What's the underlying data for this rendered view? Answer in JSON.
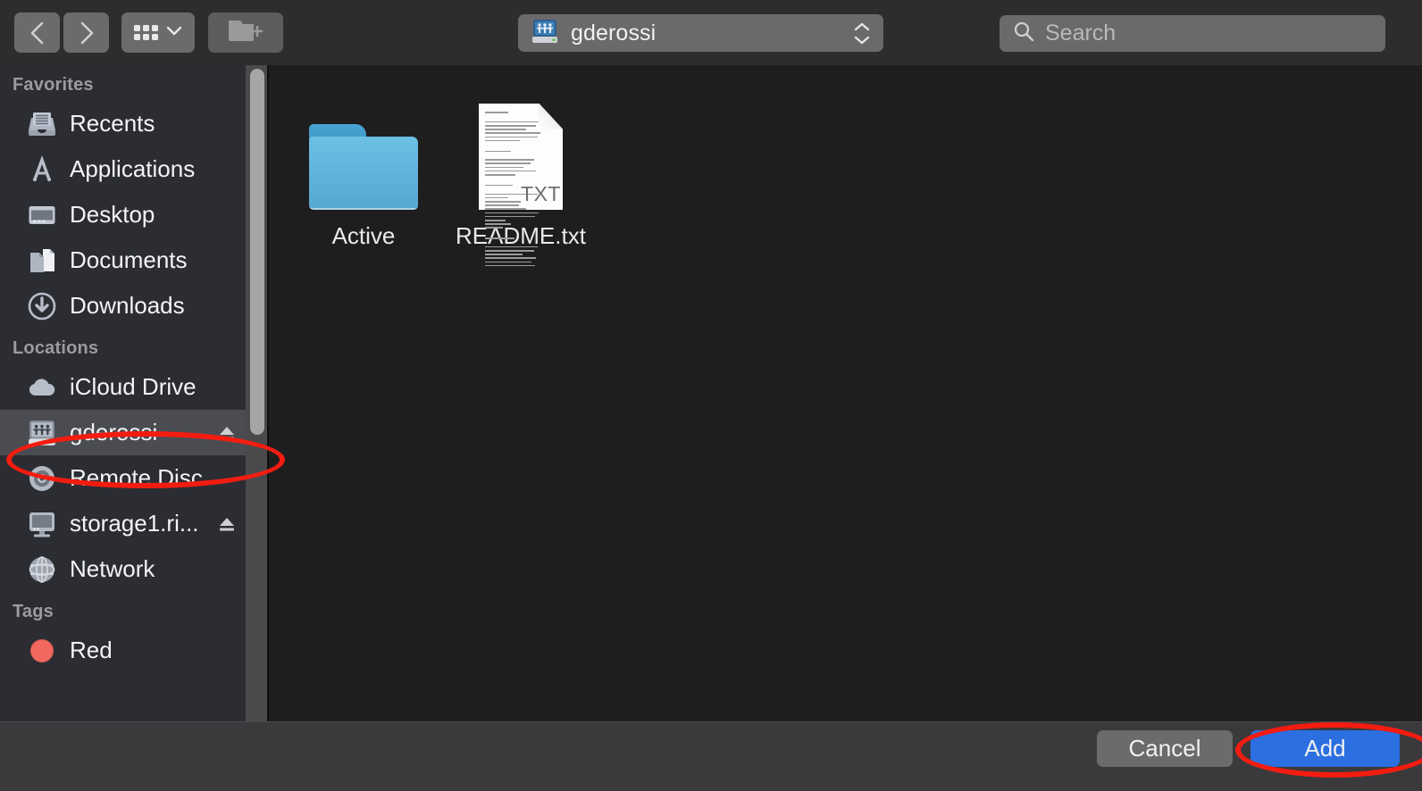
{
  "window": {
    "title": "gderossi"
  },
  "toolbar": {
    "back_button": {
      "name": "back",
      "icon": "chevron-left-icon"
    },
    "forward_button": {
      "name": "forward",
      "icon": "chevron-right-icon"
    },
    "view_button": {
      "name": "icon-view",
      "icon": "grid-icon",
      "chevron": "chevron-down-icon"
    },
    "new_folder_button": {
      "name": "new-folder",
      "icon": "folder-plus-icon"
    },
    "path_popup": {
      "value": "gderossi",
      "icon": "shared-drive-icon",
      "stepper": "up-down-chevrons-icon"
    },
    "search": {
      "placeholder": "Search",
      "value": "",
      "icon": "search-icon"
    }
  },
  "sidebar": {
    "sections": [
      {
        "title": "Favorites",
        "items": [
          {
            "label": "Recents",
            "icon": "recents-tray-icon",
            "eject": false,
            "selected": false
          },
          {
            "label": "Applications",
            "icon": "applications-icon",
            "eject": false,
            "selected": false
          },
          {
            "label": "Desktop",
            "icon": "desktop-icon",
            "eject": false,
            "selected": false
          },
          {
            "label": "Documents",
            "icon": "documents-icon",
            "eject": false,
            "selected": false
          },
          {
            "label": "Downloads",
            "icon": "downloads-icon",
            "eject": false,
            "selected": false
          }
        ]
      },
      {
        "title": "Locations",
        "items": [
          {
            "label": "iCloud Drive",
            "icon": "icloud-icon",
            "eject": false,
            "selected": false
          },
          {
            "label": "gderossi",
            "icon": "shared-drive-icon",
            "eject": true,
            "selected": true
          },
          {
            "label": "Remote Disc",
            "icon": "optical-disc-icon",
            "eject": false,
            "selected": false
          },
          {
            "label": "storage1.ri...",
            "icon": "computer-icon",
            "eject": true,
            "selected": false
          },
          {
            "label": "Network",
            "icon": "network-globe-icon",
            "eject": false,
            "selected": false
          }
        ]
      },
      {
        "title": "Tags",
        "items": [
          {
            "label": "Red",
            "icon": "red-tag-dot",
            "eject": false,
            "selected": false
          }
        ]
      }
    ],
    "scrollbar": {
      "name": "sidebar-scrollbar"
    }
  },
  "content": {
    "files": [
      {
        "name": "Active",
        "type": "folder"
      },
      {
        "name": "README.txt",
        "type": "txt",
        "extension": "TXT"
      }
    ]
  },
  "footer": {
    "cancel_label": "Cancel",
    "add_label": "Add"
  },
  "annotations": [
    {
      "name": "annotation-ellipse-gderossi",
      "color": "#f41c10",
      "target": "gderossi"
    },
    {
      "name": "annotation-ellipse-add",
      "color": "#f41c10",
      "target": "Add"
    }
  ],
  "colors": {
    "accent_blue": "#2b6fe0",
    "annotation_red": "#f41c10",
    "sidebar_bg": "#2b2d33",
    "content_bg": "#1e1e1e",
    "toolbar_bg": "#2d2d2e",
    "footer_bg": "#3a3a3c",
    "folder_blue": "#5cb2da",
    "tag_red": "#f2685f"
  }
}
